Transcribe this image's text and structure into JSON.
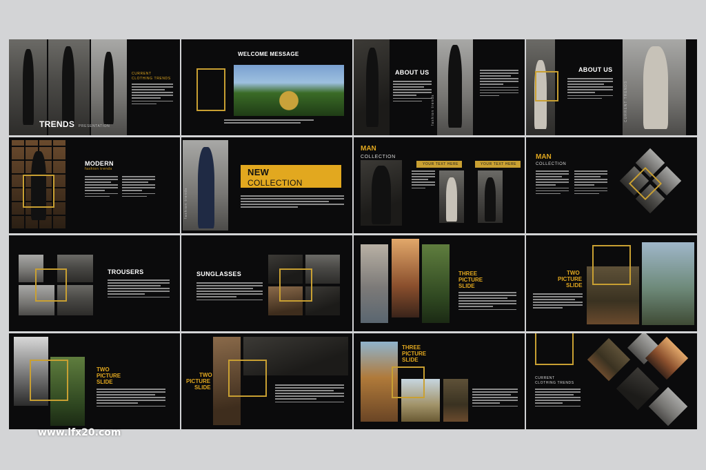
{
  "colors": {
    "accent": "#e2a81f",
    "slide_bg": "#0b0b0c",
    "page_bg": "#d3d4d6"
  },
  "slides": {
    "s1": {
      "title": "TRENDS",
      "title_sub": "PRESENTATION",
      "heading1": "CURRENT",
      "heading2": "CLOTHING TRENDS"
    },
    "s2": {
      "title": "WELCOME MESSAGE"
    },
    "s3": {
      "title": "ABOUT US",
      "vertical": "fashion trends"
    },
    "s4": {
      "title": "ABOUT US",
      "vertical": "CURRENT TRENDS"
    },
    "s5": {
      "title": "MODERN",
      "sub": "fashion trends"
    },
    "s6": {
      "title1": "NEW",
      "title2": "COLLECTION",
      "vertical": "fashion trends"
    },
    "s7": {
      "title": "MAN",
      "sub": "COLLECTION",
      "tag1": "YOUR TEXT HERE",
      "tag2": "YOUR TEXT HERE"
    },
    "s8": {
      "title": "MAN",
      "sub": "COLLECTION"
    },
    "s9": {
      "title": "TROUSERS"
    },
    "s10": {
      "title": "SUNGLASSES"
    },
    "s11": {
      "title1": "THREE",
      "title2": "PICTURE",
      "title3": "SLIDE"
    },
    "s12": {
      "title1": "TWO",
      "title2": "PICTURE",
      "title3": "SLIDE"
    },
    "s13": {
      "title1": "TWO",
      "title2": "PICTURE",
      "title3": "SLIDE"
    },
    "s14": {
      "title1": "TWO",
      "title2": "PICTURE",
      "title3": "SLIDE"
    },
    "s15": {
      "title1": "THREE",
      "title2": "PICTURE",
      "title3": "SLIDE"
    },
    "s16": {
      "heading1": "CURRENT",
      "heading2": "CLOTHING TRENDS"
    }
  },
  "watermark": "www.lfx20.com"
}
